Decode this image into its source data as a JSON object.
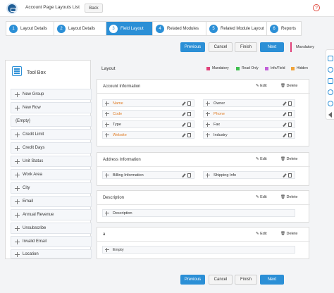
{
  "header": {
    "title": "Account Page Layouts List",
    "back_label": "Back",
    "help_label": "?"
  },
  "steps": [
    {
      "num": "1",
      "label": "Layout Details",
      "active": false
    },
    {
      "num": "2",
      "label": "Layout Details",
      "active": false
    },
    {
      "num": "3",
      "label": "Field Layout",
      "active": true
    },
    {
      "num": "4",
      "label": "Related Modules",
      "active": false
    },
    {
      "num": "5",
      "label": "Related Module Layout",
      "active": false
    },
    {
      "num": "6",
      "label": "Reports",
      "active": false
    }
  ],
  "actions": {
    "previous": "Previous",
    "cancel": "Cancel",
    "finish": "Finish",
    "next": "Next"
  },
  "mandatory_note": "Mandatory",
  "toolbox": {
    "title": "Tool Box",
    "items": [
      {
        "label": "New Group",
        "movable": true
      },
      {
        "label": "New Row",
        "movable": true
      },
      {
        "label": "{Empty}",
        "movable": false
      },
      {
        "label": "Credit Limit",
        "movable": true
      },
      {
        "label": "Credit Days",
        "movable": true
      },
      {
        "label": "Unit Status",
        "movable": true
      },
      {
        "label": "Work Area",
        "movable": true
      },
      {
        "label": "City",
        "movable": true
      },
      {
        "label": "Email",
        "movable": true
      },
      {
        "label": "Annual Revenue",
        "movable": true
      },
      {
        "label": "Unsubscribe",
        "movable": true
      },
      {
        "label": "Invalid Email",
        "movable": true
      },
      {
        "label": "Location",
        "movable": true
      }
    ]
  },
  "layout": {
    "label": "Layout",
    "legend": [
      {
        "label": "Mandatory",
        "color": "#e0417a"
      },
      {
        "label": "Read Only",
        "color": "#3fbf4f"
      },
      {
        "label": "Info/Field",
        "color": "#c25fd8"
      },
      {
        "label": "Hidden",
        "color": "#f0a33a"
      }
    ],
    "edit_label": "Edit",
    "delete_label": "Delete",
    "sections": [
      {
        "title": "Account Information",
        "left_fields": [
          {
            "label": "Name",
            "orange": true
          },
          {
            "label": "Code",
            "orange": true
          },
          {
            "label": "Type",
            "orange": false
          },
          {
            "label": "Website",
            "orange": true
          }
        ],
        "right_fields": [
          {
            "label": "Owner",
            "orange": false
          },
          {
            "label": "Phone",
            "orange": true
          },
          {
            "label": "Fax",
            "orange": false
          },
          {
            "label": "Industry",
            "orange": false
          }
        ]
      },
      {
        "title": "Address Information",
        "left_fields": [
          {
            "label": "Billing Information",
            "orange": false
          }
        ],
        "right_fields": [
          {
            "label": "Shipping Info",
            "orange": false
          }
        ]
      },
      {
        "title": "Description",
        "full_field": "Description"
      },
      {
        "title": "a",
        "full_field": "Empty"
      }
    ]
  },
  "colors": {
    "primary": "#2b8fd6",
    "mandatory": "#e0417a",
    "accent_orange": "#e07c25"
  }
}
